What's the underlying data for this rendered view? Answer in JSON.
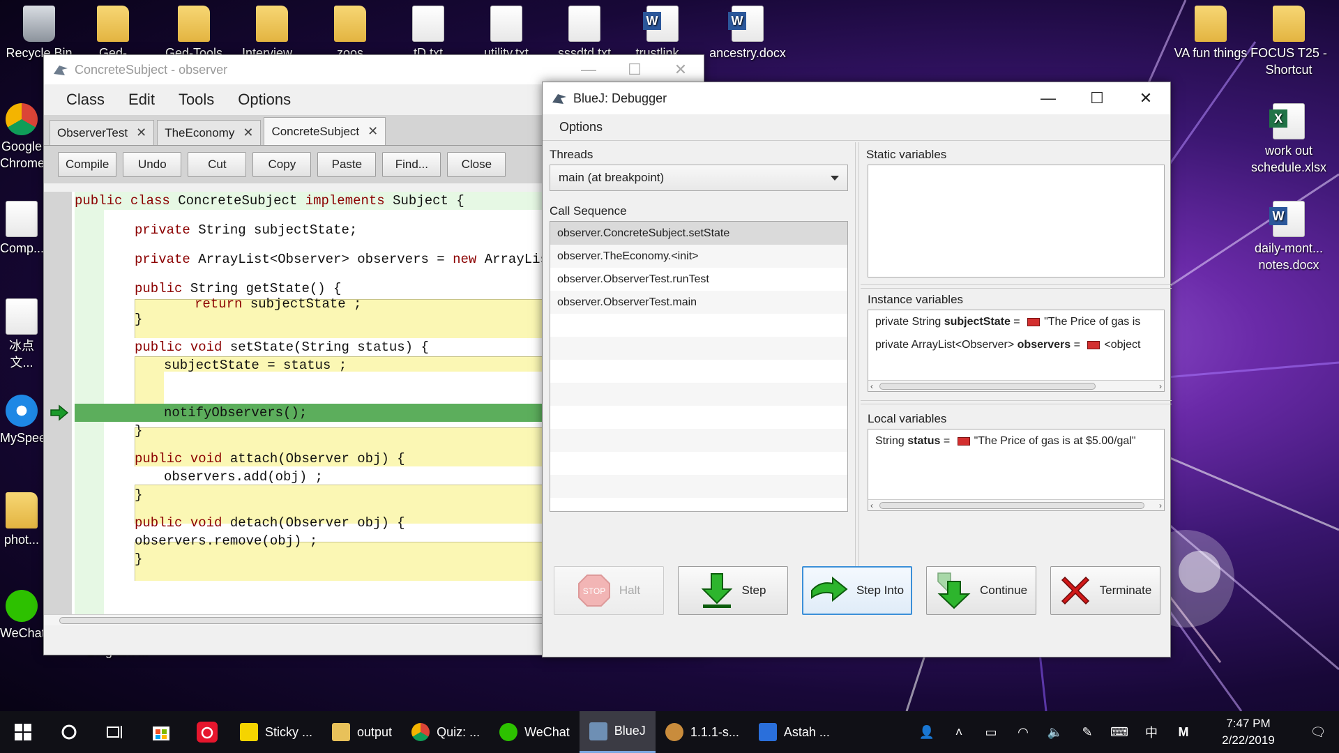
{
  "desktop_icons": [
    {
      "label": "Recycle Bin",
      "type": "bin"
    },
    {
      "label": "Ged-Summ...",
      "type": "folder"
    },
    {
      "label": "Ged-Tools",
      "type": "folder"
    },
    {
      "label": "Interview...",
      "type": "folder"
    },
    {
      "label": "zoos",
      "type": "folder"
    },
    {
      "label": "tD.txt",
      "type": "file"
    },
    {
      "label": "utility.txt",
      "type": "file"
    },
    {
      "label": "sssdtd.txt",
      "type": "file"
    },
    {
      "label": "trustlink...",
      "type": "word"
    },
    {
      "label": "ancestry.docx",
      "type": "word"
    },
    {
      "label": "VA fun things",
      "type": "folder"
    },
    {
      "label": "FOCUS T25 - Shortcut",
      "type": "folder"
    },
    {
      "label": "work out schedule.xlsx",
      "type": "excel"
    },
    {
      "label": "daily-mont... notes.docx",
      "type": "word"
    },
    {
      "label": "Google Chrome",
      "type": "chrome"
    },
    {
      "label": "Comp...",
      "type": "file"
    },
    {
      "label": "冰点文...",
      "type": "file"
    },
    {
      "label": "MySpeed",
      "type": "ie"
    },
    {
      "label": "phot...",
      "type": "folder"
    },
    {
      "label": "WeChat",
      "type": "wechat"
    },
    {
      "label": "Diagram ...",
      "type": "file"
    }
  ],
  "editor": {
    "title": "ConcreteSubject - observer",
    "menu": [
      "Class",
      "Edit",
      "Tools",
      "Options"
    ],
    "tabs": [
      {
        "label": "ObserverTest",
        "close": "✕"
      },
      {
        "label": "TheEconomy",
        "close": "✕"
      },
      {
        "label": "ConcreteSubject",
        "close": "✕"
      }
    ],
    "toolbar": [
      "Compile",
      "Undo",
      "Cut",
      "Copy",
      "Paste",
      "Find...",
      "Close"
    ],
    "code": {
      "l1_kw1": "public",
      "l1_kw2": "class",
      "l1_a": " ConcreteSubject ",
      "l1_kw3": "implements",
      "l1_b": " Subject {",
      "l2": "private String subjectState;",
      "l3_a": "private ArrayList<Observer> observers = ",
      "l3_kw": "new",
      "l3_b": " ArrayList<",
      "l4_kw": "public",
      "l4_a": " String getState() {",
      "l5_kw": "return",
      "l5_a": " subjectState ;",
      "l6": "}",
      "l7_kw1": "public",
      "l7_kw2": "void",
      "l7_a": " setState(String status) {",
      "l8": "subjectState = status ;",
      "l9": "notifyObservers();",
      "l10": "}",
      "l11_kw1": "public",
      "l11_kw2": "void",
      "l11_a": " attach(Observer obj) {",
      "l12": "observers.add(obj) ;",
      "l13": "}",
      "l14_kw1": "public",
      "l14_kw2": "void",
      "l14_a": " detach(Observer obj) {",
      "l15": "observers.remove(obj) ;",
      "l16": "}"
    }
  },
  "debugger": {
    "title": "BlueJ:  Debugger",
    "menu": "Options",
    "threads_label": "Threads",
    "thread_selected": "main (at breakpoint)",
    "call_sequence_label": "Call Sequence",
    "call_sequence": [
      "observer.ConcreteSubject.setState",
      "observer.TheEconomy.<init>",
      "observer.ObserverTest.runTest",
      "observer.ObserverTest.main"
    ],
    "static_label": "Static variables",
    "instance_label": "Instance variables",
    "instance_vars": [
      {
        "decl": "private  String ",
        "name": "subjectState",
        "eq": " = ",
        "value": "\"The Price of gas is"
      },
      {
        "decl": "private  ArrayList<Observer> ",
        "name": "observers",
        "eq": " = ",
        "value": "<object"
      }
    ],
    "local_label": "Local variables",
    "local_vars": [
      {
        "decl": "String ",
        "name": "status",
        "eq": " = ",
        "value": "\"The Price of gas is at $5.00/gal\""
      }
    ],
    "buttons": {
      "halt": "Halt",
      "halt_icon_text": "STOP",
      "step": "Step",
      "step_into": "Step Into",
      "continue": "Continue",
      "terminate": "Terminate"
    }
  },
  "taskbar": {
    "apps": [
      {
        "label": "Sticky ...",
        "color": "#f5d400"
      },
      {
        "label": "output",
        "color": "#e8c15a"
      },
      {
        "label": "Quiz: ...",
        "color": "#db4437"
      },
      {
        "label": "WeChat",
        "color": "#2dc100"
      },
      {
        "label": "BlueJ",
        "color": "#6e8fb4"
      },
      {
        "label": "1.1.1-s...",
        "color": "#c98c3c"
      },
      {
        "label": "Astah ...",
        "color": "#2a6fdb"
      }
    ],
    "ime": "中",
    "ime2": "M",
    "time": "7:47 PM",
    "date": "2/22/2019"
  }
}
